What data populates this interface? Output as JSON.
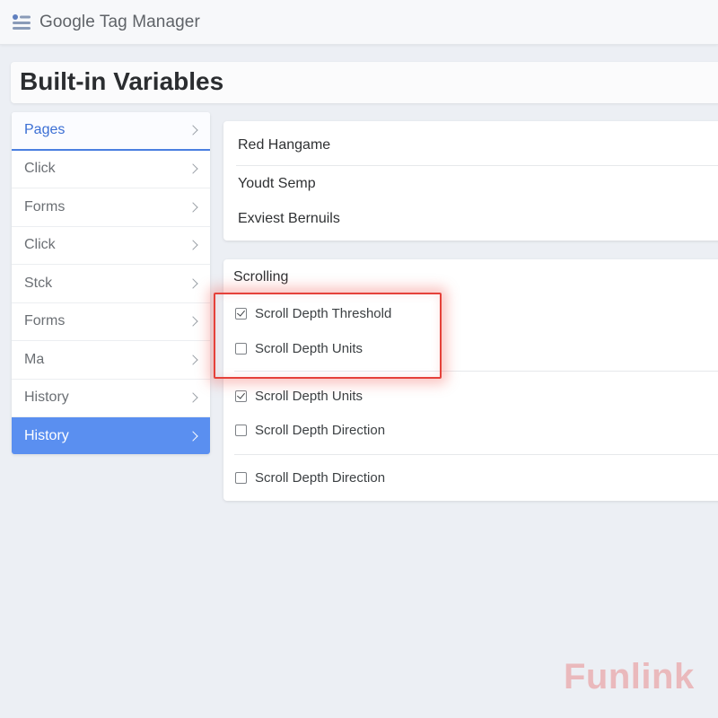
{
  "header": {
    "app_title": "Google Tag Manager",
    "icon": "tag-manager-menu-icon"
  },
  "page": {
    "title": "Built-in Variables"
  },
  "sidebar": {
    "items": [
      {
        "label": "Pages",
        "state": "selected"
      },
      {
        "label": "Click",
        "state": "normal"
      },
      {
        "label": "Forms",
        "state": "normal"
      },
      {
        "label": "Click",
        "state": "normal"
      },
      {
        "label": "Stck",
        "state": "normal"
      },
      {
        "label": "Forms",
        "state": "normal"
      },
      {
        "label": "Ma",
        "state": "normal"
      },
      {
        "label": "History",
        "state": "normal"
      },
      {
        "label": "History",
        "state": "active"
      }
    ]
  },
  "upper_card": {
    "rows": [
      "Red Hangame",
      "Youdt Semp",
      "Exviest Bernuils"
    ]
  },
  "scrolling_card": {
    "title": "Scrolling",
    "options": [
      {
        "label": "Scroll Depth Threshold",
        "checked": true
      },
      {
        "label": "Scroll Depth Units",
        "checked": false
      },
      {
        "label": "Scroll Depth Units",
        "checked": true
      },
      {
        "label": "Scroll Depth Direction",
        "checked": false
      },
      {
        "label": "Scroll Depth Direction",
        "checked": false
      }
    ]
  },
  "watermark": "Funlink",
  "colors": {
    "accent": "#5a8ff0",
    "highlight": "#e5413a",
    "selected_text": "#3b6fd4"
  }
}
